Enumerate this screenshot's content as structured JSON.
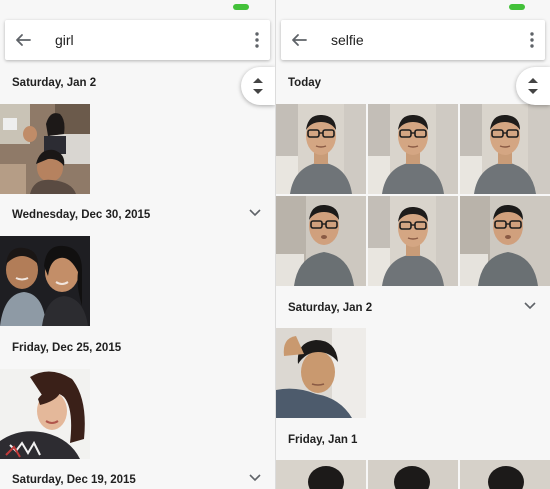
{
  "left_panel": {
    "search": {
      "query": "girl"
    },
    "sections": [
      {
        "date": "Saturday, Jan 2"
      },
      {
        "date": "Wednesday, Dec 30, 2015"
      },
      {
        "date": "Friday, Dec 25, 2015"
      },
      {
        "date": "Saturday, Dec 19, 2015"
      }
    ]
  },
  "right_panel": {
    "search": {
      "query": "selfie"
    },
    "sections": [
      {
        "date": "Today"
      },
      {
        "date": "Saturday, Jan 2"
      },
      {
        "date": "Friday, Jan 1"
      }
    ]
  },
  "icons": {
    "back": "arrow-back-icon",
    "more": "more-vert-icon",
    "expand": "chevron-down-icon",
    "scroll": "fast-scroll-icon"
  },
  "colors": {
    "status_indicator": "#43c13a",
    "background": "#f7f7f7",
    "search_bar": "#ffffff"
  }
}
